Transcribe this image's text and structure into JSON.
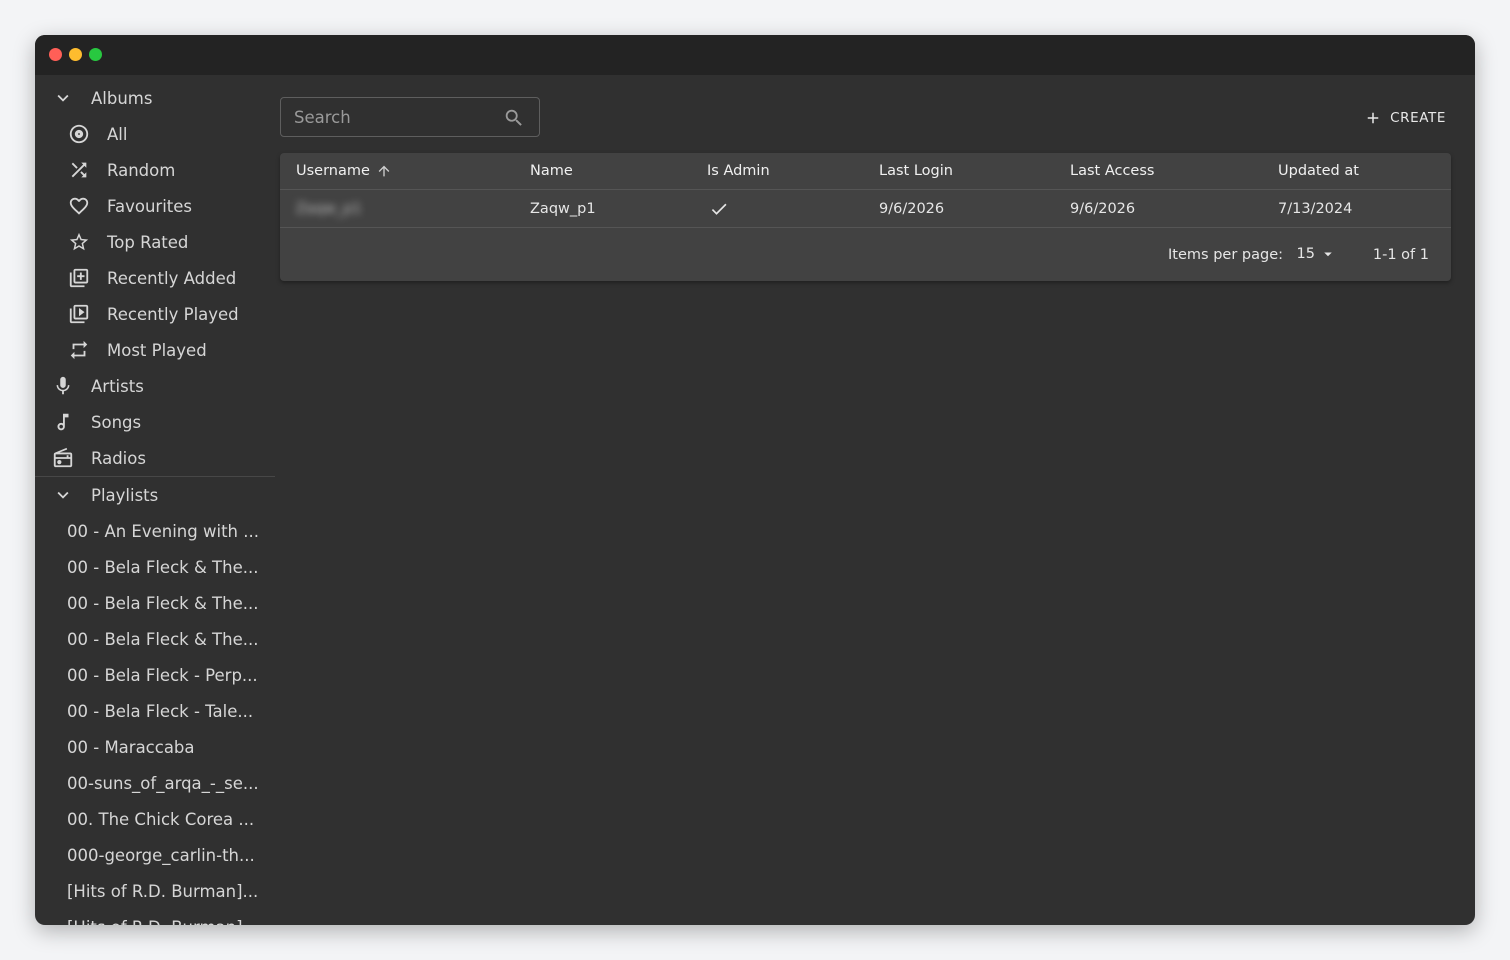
{
  "sidebar": {
    "albums_label": "Albums",
    "album_items": [
      {
        "label": "All",
        "icon": "disc-icon"
      },
      {
        "label": "Random",
        "icon": "shuffle-icon"
      },
      {
        "label": "Favourites",
        "icon": "heart-icon"
      },
      {
        "label": "Top Rated",
        "icon": "star-icon"
      },
      {
        "label": "Recently Added",
        "icon": "library-add-icon"
      },
      {
        "label": "Recently Played",
        "icon": "library-play-icon"
      },
      {
        "label": "Most Played",
        "icon": "repeat-icon"
      }
    ],
    "artists_label": "Artists",
    "songs_label": "Songs",
    "radios_label": "Radios",
    "playlists_label": "Playlists",
    "playlists": [
      "00 - An Evening with ...",
      "00 - Bela Fleck & The...",
      "00 - Bela Fleck & The...",
      "00 - Bela Fleck & The...",
      "00 - Bela Fleck - Perp...",
      "00 - Bela Fleck - Tale...",
      "00 - Maraccaba",
      "00-suns_of_arqa_-_se...",
      "00. The Chick Corea ...",
      "000-george_carlin-th...",
      "[Hits of R.D. Burman]...",
      "[Hits of R.D. Burman]..."
    ]
  },
  "toolbar": {
    "search_placeholder": "Search",
    "create_label": "CREATE"
  },
  "table": {
    "columns": [
      "Username",
      "Name",
      "Is Admin",
      "Last Login",
      "Last Access",
      "Updated at"
    ],
    "rows": [
      {
        "username": "Zaqw_p1",
        "name": "Zaqw_p1",
        "is_admin": true,
        "last_login": "9/6/2026",
        "last_access": "9/6/2026",
        "updated_at": "7/13/2024"
      }
    ]
  },
  "pagination": {
    "items_per_page_label": "Items per page:",
    "items_per_page": "15",
    "range": "1-1 of 1"
  }
}
